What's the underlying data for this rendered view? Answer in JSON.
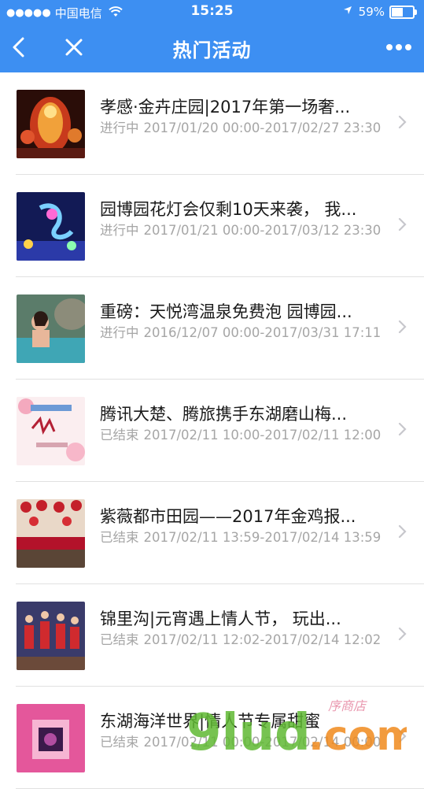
{
  "status": {
    "carrier": "中国电信",
    "time": "15:25",
    "battery": "59%",
    "battery_level": 0.59
  },
  "nav": {
    "title": "热门活动"
  },
  "items": [
    {
      "title": "孝感·金卉庄园|2017年第一场奢...",
      "status": "进行中",
      "range": "2017/01/20 00:00-2017/02/27 23:30"
    },
    {
      "title": "园博园花灯会仅剩10天来袭， 我...",
      "status": "进行中",
      "range": "2017/01/21 00:00-2017/03/12 23:30"
    },
    {
      "title": "重磅：天悦湾温泉免费泡 园博园...",
      "status": "进行中",
      "range": "2016/12/07 00:00-2017/03/31 17:11"
    },
    {
      "title": "腾讯大楚、腾旅携手东湖磨山梅...",
      "status": "已结束",
      "range": "2017/02/11 10:00-2017/02/11 12:00"
    },
    {
      "title": "紫薇都市田园——2017年金鸡报...",
      "status": "已结束",
      "range": "2017/02/11 13:59-2017/02/14 13:59"
    },
    {
      "title": "锦里沟|元宵遇上情人节， 玩出...",
      "status": "已结束",
      "range": "2017/02/11 12:02-2017/02/14 12:02"
    },
    {
      "title": "东湖海洋世界|情人节专属甜蜜",
      "status": "已结束",
      "range": "2017/02/11 00:00-2017/02/14 00:00"
    }
  ],
  "watermark": {
    "text": "9lud.com",
    "sub": "序商店"
  }
}
